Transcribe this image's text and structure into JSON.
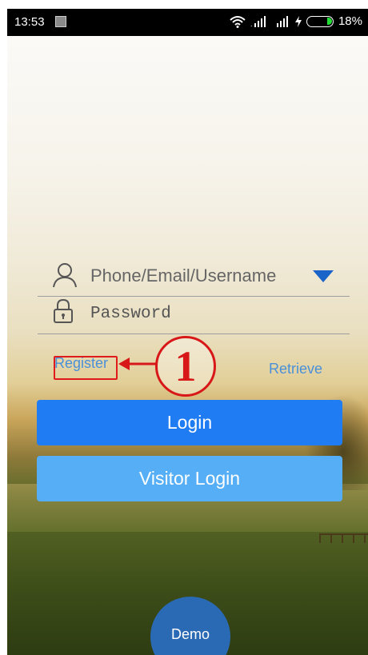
{
  "status_bar": {
    "time": "13:53",
    "battery_percent": "18%",
    "icons": [
      "gallery-icon",
      "wifi-icon",
      "signal-icon",
      "signal-icon",
      "charging-icon",
      "battery-icon"
    ]
  },
  "login_form": {
    "username": {
      "placeholder": "Phone/Email/Username",
      "value": "",
      "icon": "user-icon",
      "dropdown_icon": "chevron-down-icon"
    },
    "password": {
      "placeholder": "Password",
      "value": "",
      "icon": "lock-icon"
    },
    "register_label": "Register",
    "retrieve_label": "Retrieve",
    "login_label": "Login",
    "visitor_login_label": "Visitor Login"
  },
  "annotation": {
    "number": "1"
  },
  "demo_label": "Demo",
  "colors": {
    "login_button": "#1f7cf3",
    "visitor_button": "#55aef6",
    "link": "#4a90d9",
    "annotation": "#d81818",
    "demo_button": "#2a6ab4",
    "dropdown": "#1a63c8"
  }
}
